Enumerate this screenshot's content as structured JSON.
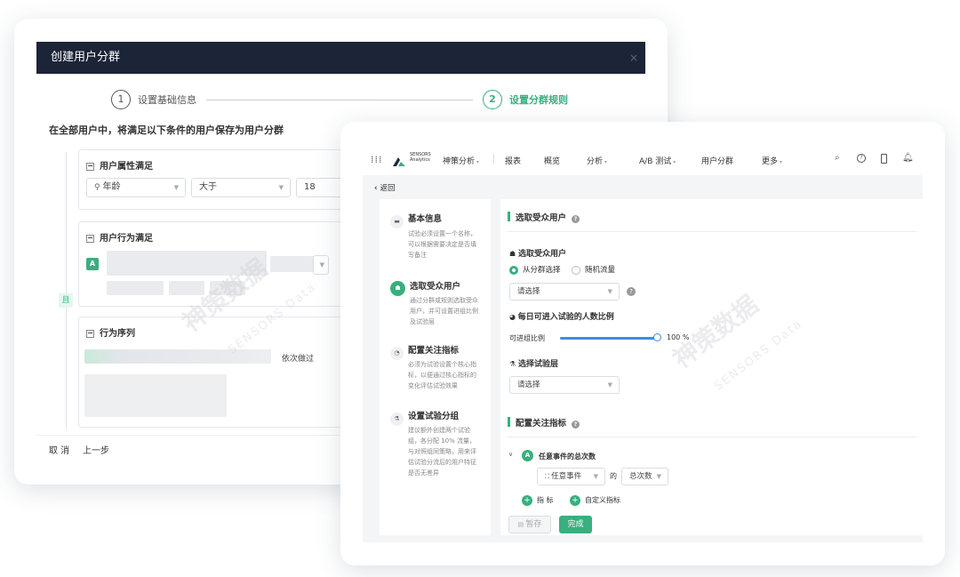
{
  "back_dialog": {
    "title": "创建用户分群",
    "close": "×",
    "steps": [
      {
        "num": "1",
        "label": "设置基础信息"
      },
      {
        "num": "2",
        "label": "设置分群规则"
      }
    ],
    "subtitle": "在全部用户中，将满足以下条件的用户保存为用户分群",
    "and_label": "且",
    "group1": {
      "title": "用户属性满足",
      "prop": "年龄",
      "op": "大于",
      "val": "18"
    },
    "group2": {
      "title": "用户行为满足",
      "tag": "A"
    },
    "group3": {
      "title": "行为序列",
      "seq_label": "依次做过"
    },
    "footer": {
      "cancel": "取 消",
      "prev": "上一步"
    }
  },
  "front_app": {
    "brand": {
      "logo_top": "SENSORS",
      "logo_bottom": "Analytics",
      "product": "神策分析"
    },
    "nav": [
      "报表",
      "概览",
      "分析",
      "A/B 测试",
      "用户分群",
      "更多"
    ],
    "back": "返回",
    "left_steps": [
      {
        "title": "基本信息",
        "desc": "试验必须设置一个名称，可以根据需要决定是否填写备注"
      },
      {
        "title": "选取受众用户",
        "desc": "通过分群或规则选取受众用户，并可设置进组比例及试验层"
      },
      {
        "title": "配置关注指标",
        "desc": "必须为试验设置个核心指标，以便通过核心指标的变化评估试验效果"
      },
      {
        "title": "设置试验分组",
        "desc": "建议额外创建两个试验组，各分配 10% 流量，与对照组同策略，用来评估试验分流后的用户特征是否无差异"
      }
    ],
    "main": {
      "section1": "选取受众用户",
      "audience_label": "选取受众用户",
      "radio_segment": "从分群选择",
      "radio_random": "随机流量",
      "select_placeholder": "请选择",
      "daily_ratio_label": "每日可进入试验的人数比例",
      "ratio_label": "可进组比例",
      "ratio_value": "100 %",
      "layer_label": "选择试验层",
      "layer_placeholder": "请选择",
      "section2": "配置关注指标",
      "metric_tag": "A",
      "metric_name": "任意事件的总次数",
      "event_select": "任意事件",
      "of": "的",
      "agg_select": "总次数",
      "add_metric": "指 标",
      "custom_metric": "自定义指标",
      "save_btn": "暂存",
      "done_btn": "完成"
    }
  },
  "watermark": {
    "cn": "神策数据",
    "en": "SENSORS Data"
  },
  "colors": {
    "accent": "#3aae7e",
    "header": "#1c2438"
  }
}
